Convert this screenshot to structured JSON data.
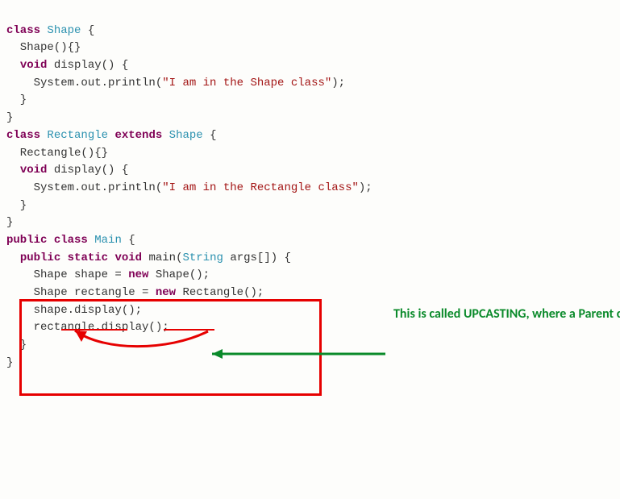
{
  "code": {
    "l1a": "class",
    "l1b": "Shape",
    "l1c": " {",
    "l2a": "  Shape(){}",
    "l3a": "  ",
    "l3b": "void",
    "l3c": " display() {",
    "l4a": "    System.out.println(",
    "l4b": "\"I am in the Shape class\"",
    "l4c": ");",
    "l5": "  }",
    "l6": "}",
    "blank": "",
    "l8a": "class",
    "l8b": "Rectangle",
    "l8c": "extends",
    "l8d": "Shape",
    "l8e": " {",
    "l9": "  Rectangle(){}",
    "l10a": "  ",
    "l10b": "void",
    "l10c": " display() {",
    "l11a": "    System.out.println(",
    "l11b": "\"I am in the Rectangle class\"",
    "l11c": ");",
    "l12": "  }",
    "l13": "}",
    "l15a": "public",
    "l15b": "class",
    "l15c": "Main",
    "l15d": " {",
    "l16a": "  ",
    "l16b": "public",
    "l16c": "static",
    "l16d": "void",
    "l16e": " main(",
    "l16f": "String",
    "l16g": " args[]) {",
    "l17a": "    Shape shape = ",
    "l17b": "new",
    "l17c": " Shape();",
    "l18a": "    Shape rectangle = ",
    "l18b": "new",
    "l18c": " Rectangle();",
    "l20": "    shape.display();",
    "l21": "    rectangle.display();",
    "l22": "  }",
    "l23": "}"
  },
  "annotation": {
    "text": "This is called UPCASTING, where a Parent class reference variable refers to Child class object"
  }
}
